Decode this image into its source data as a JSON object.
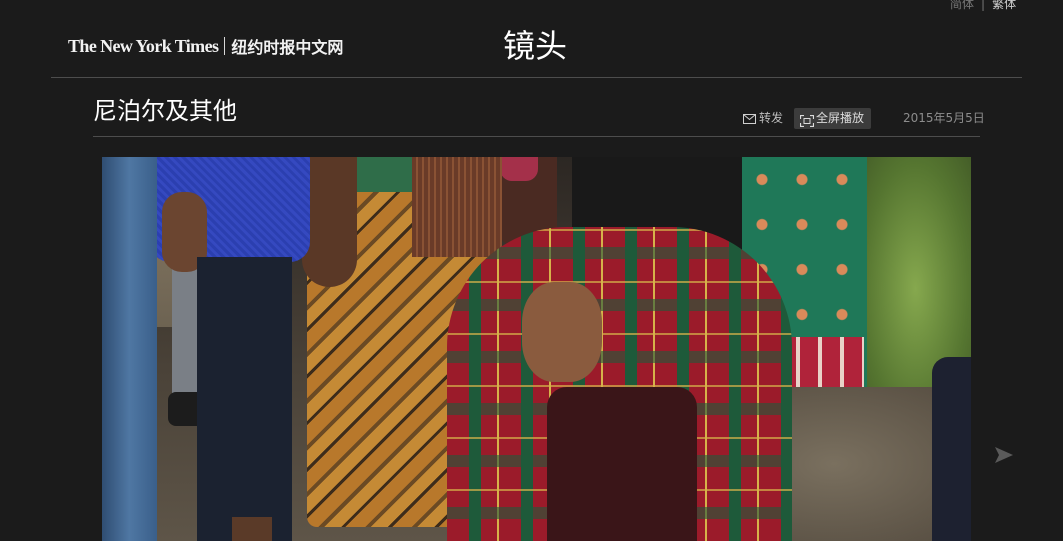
{
  "lang_switch": {
    "simplified": "简体",
    "separator": "|",
    "traditional": "繁体"
  },
  "header": {
    "logo_en": "The New York Times",
    "logo_cn": "纽约时报中文网",
    "section_title": "镜头"
  },
  "article": {
    "title": "尼泊尔及其他",
    "share_label": "转发",
    "fullscreen_label": "全屏播放",
    "date": "2015年5月5日"
  },
  "icons": {
    "share": "envelope-icon",
    "fullscreen": "fullscreen-icon",
    "next": "next-arrow-icon"
  },
  "colors": {
    "page_background": "#1b1b1b",
    "divider": "#4d4d4d",
    "title_text": "#ffffff",
    "muted_text": "#8c8c8c",
    "button_background": "#3c3c3c"
  }
}
